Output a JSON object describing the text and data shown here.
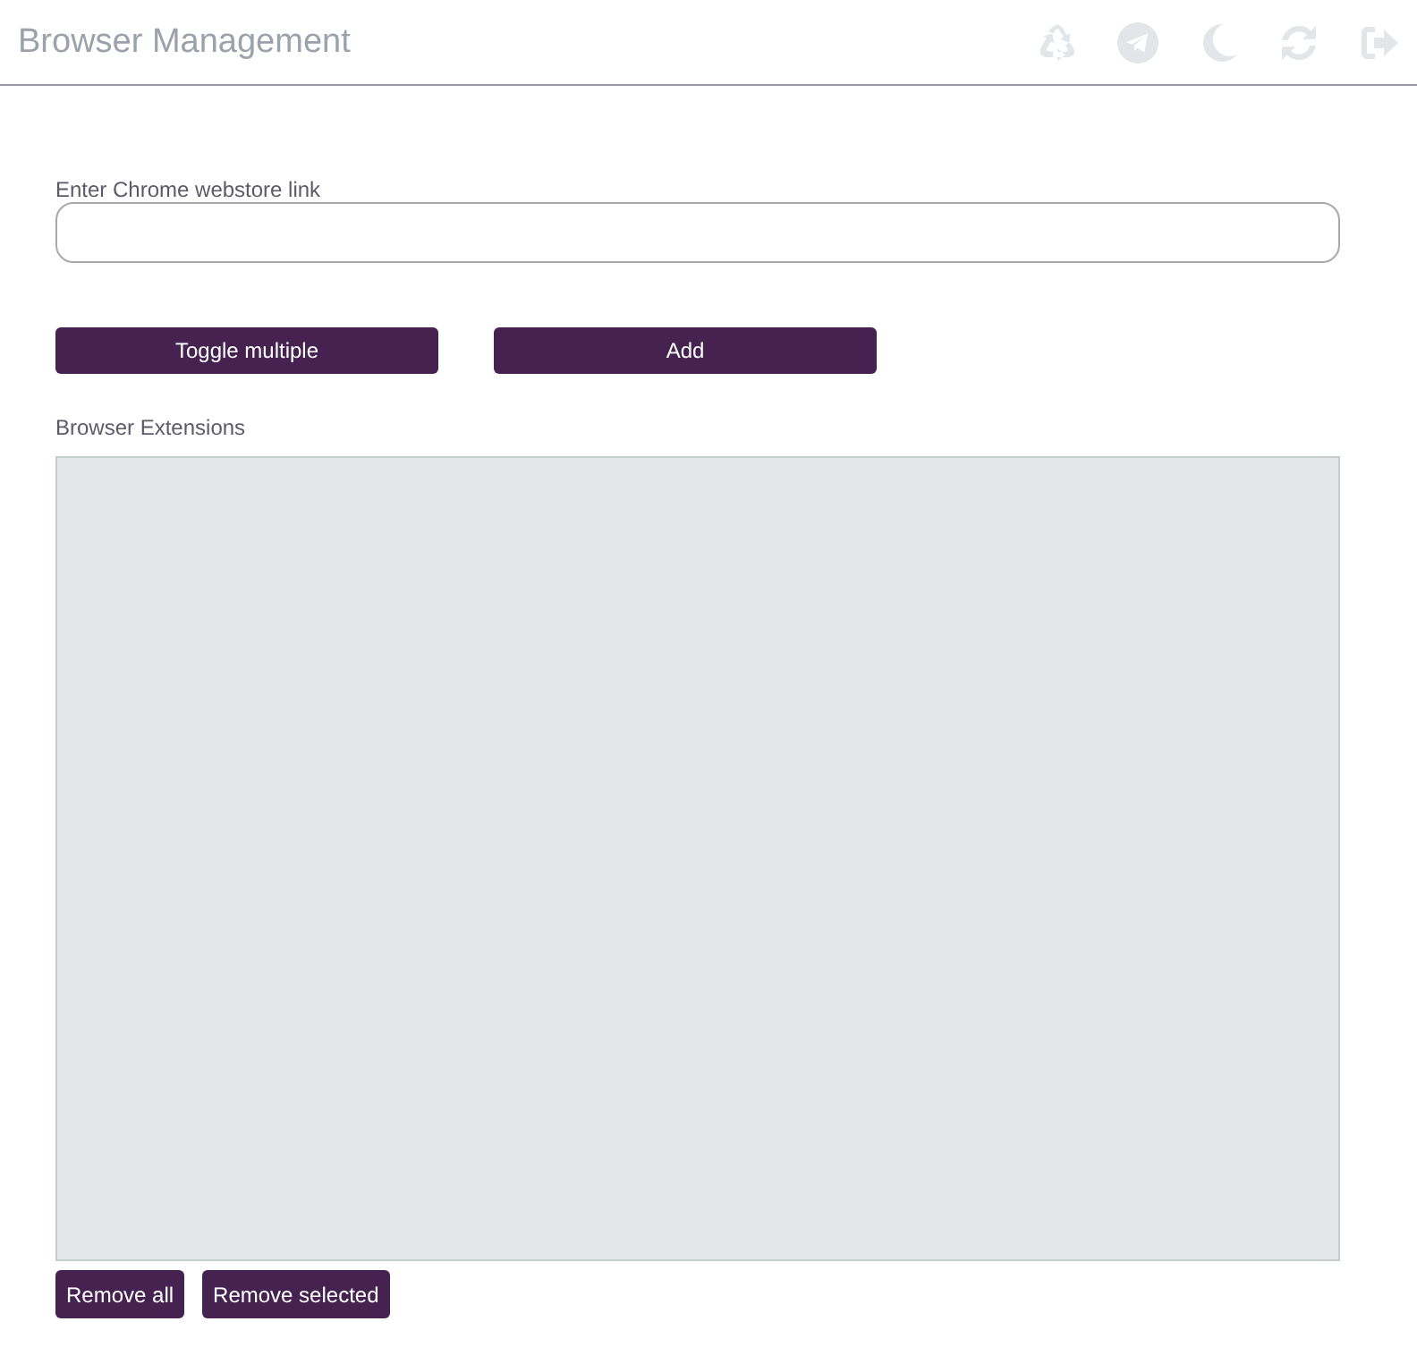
{
  "header": {
    "title": "Browser Management"
  },
  "link_field": {
    "label": "Enter Chrome webstore link"
  },
  "actions": [
    "Toggle multiple",
    "Add"
  ],
  "extensions": {
    "label": "Browser Extensions"
  },
  "list_actions": [
    "Remove all",
    "Remove selected"
  ]
}
